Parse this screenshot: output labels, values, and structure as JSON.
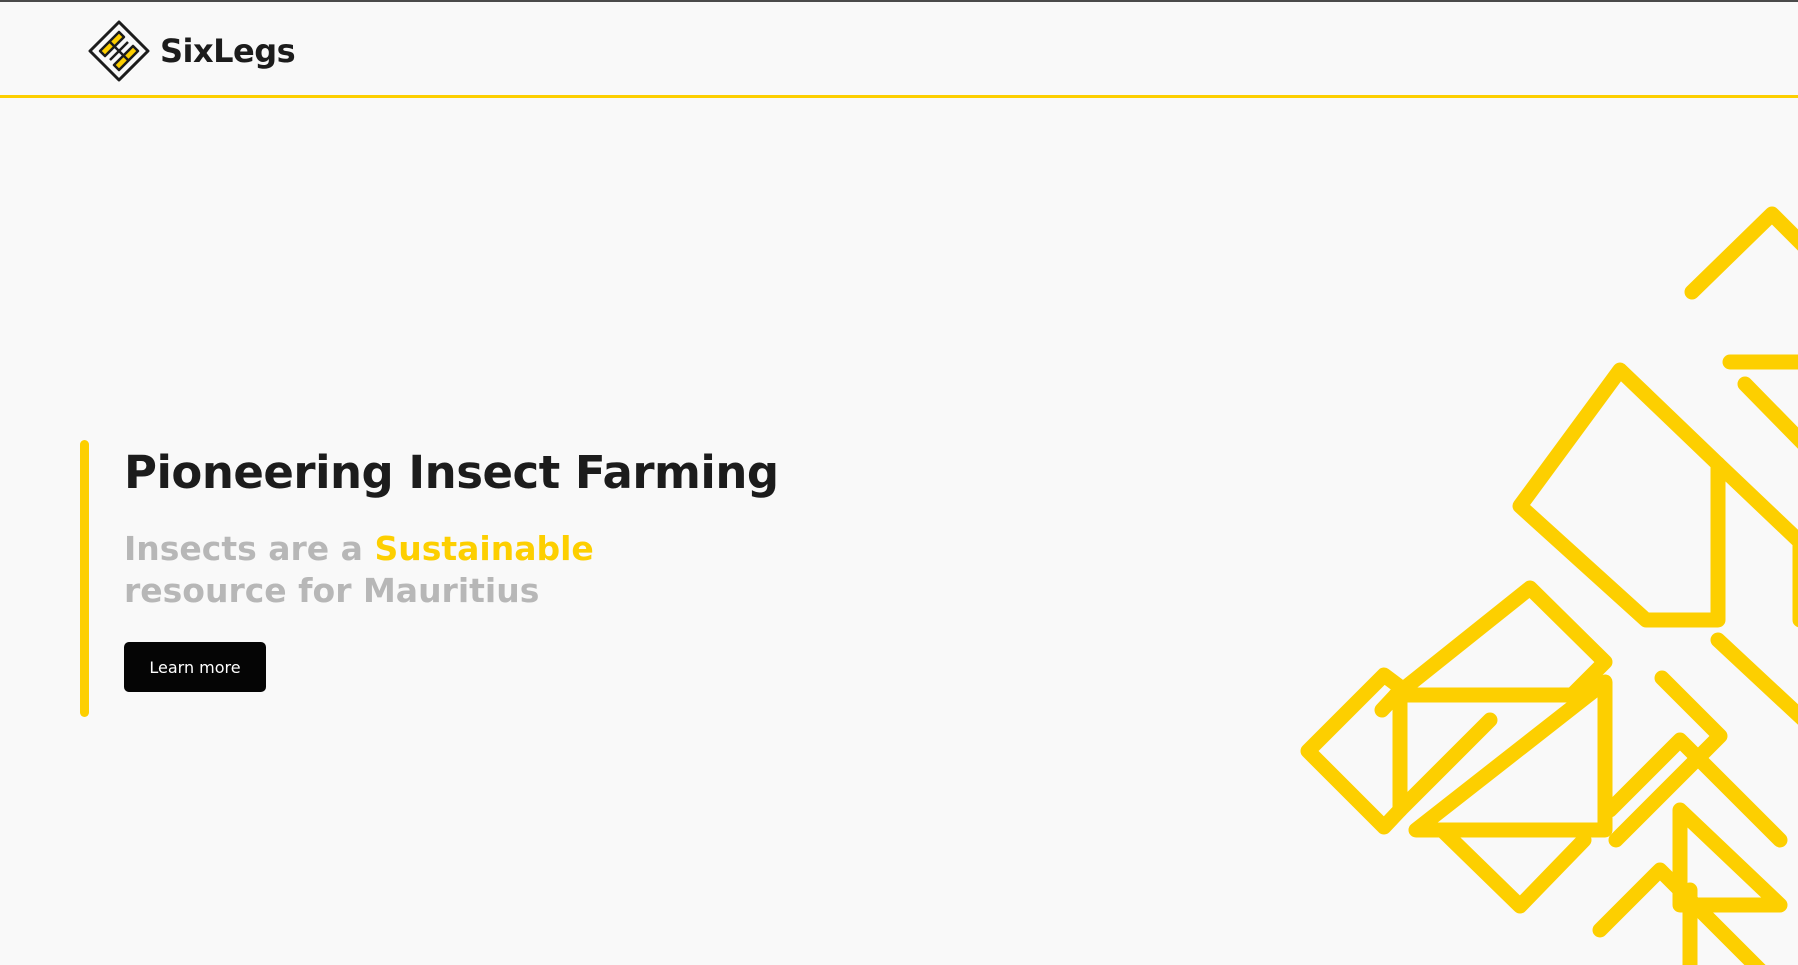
{
  "brand": {
    "name": "SixLegs",
    "accent_color": "#fdcf00",
    "logo_icon": "diamond-logo-icon"
  },
  "hero": {
    "title": "Pioneering Insect Farming",
    "subtitle_part1": "Insects are a ",
    "subtitle_highlight": "Sustainable",
    "subtitle_part2": "resource for Mauritius",
    "button_label": "Learn more"
  },
  "decoration": {
    "pattern_icon": "geometric-pattern-icon",
    "color": "#fdcf00"
  }
}
